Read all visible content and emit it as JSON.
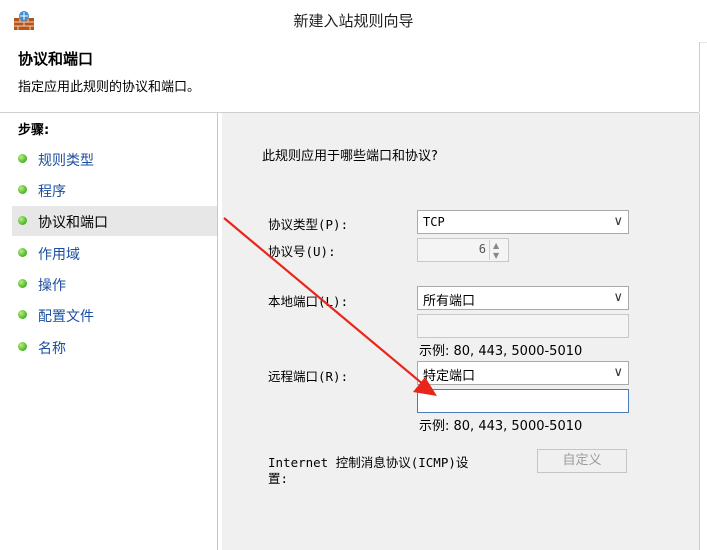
{
  "window": {
    "title": "新建入站规则向导",
    "icon": "firewall-icon"
  },
  "header": {
    "title": "协议和端口",
    "description": "指定应用此规则的协议和端口。"
  },
  "sidebar": {
    "heading": "步骤:",
    "items": [
      {
        "label": "规则类型"
      },
      {
        "label": "程序"
      },
      {
        "label": "协议和端口",
        "active": true
      },
      {
        "label": "作用域"
      },
      {
        "label": "操作"
      },
      {
        "label": "配置文件"
      },
      {
        "label": "名称"
      }
    ]
  },
  "main": {
    "question": "此规则应用于哪些端口和协议?",
    "protocol_type": {
      "label": "协议类型(P):",
      "value": "TCP"
    },
    "protocol_number": {
      "label": "协议号(U):",
      "value": "6"
    },
    "local_port": {
      "label": "本地端口(L):",
      "value": "所有端口",
      "example": "示例: 80, 443, 5000-5010"
    },
    "remote_port": {
      "label": "远程端口(R):",
      "value": "特定端口",
      "input_value": "",
      "example": "示例: 80, 443, 5000-5010"
    },
    "icmp": {
      "label_line1": "Internet 控制消息协议(ICMP)设",
      "label_line2": "置:",
      "button": "自定义"
    }
  },
  "colors": {
    "link": "#1c4fa3",
    "annotation_arrow": "#e8261c",
    "step_dot": "#48b227"
  }
}
